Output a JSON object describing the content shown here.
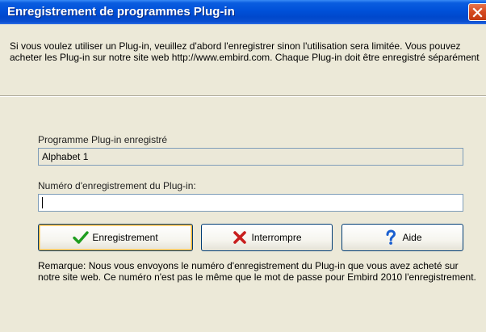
{
  "window": {
    "title": "Enregistrement de programmes Plug-in"
  },
  "intro_text": "Si vous voulez utiliser un Plug-in, veuillez d'abord l'enregistrer sinon l'utilisation sera limitée. Vous pouvez acheter les Plug-in sur notre site web http://www.embird.com. Chaque Plug-in doit être enregistré séparément",
  "form": {
    "registered_label": "Programme Plug-in enregistré",
    "registered_value": "Alphabet 1",
    "number_label": "Numéro d'enregistrement du Plug-in:",
    "number_value": ""
  },
  "buttons": {
    "register": "Enregistrement",
    "cancel": "Interrompre",
    "help": "Aide"
  },
  "remark_text": "Remarque: Nous vous envoyons le numéro d'enregistrement du Plug-in que vous avez acheté sur notre site web. Ce numéro n'est pas le même que le mot de passe pour Embird 2010 l'enregistrement.",
  "icons": {
    "close": "close-icon",
    "register": "green-checkmark-icon",
    "cancel": "red-x-icon",
    "help": "blue-question-mark-icon"
  },
  "colors": {
    "titlebar": "#0050d8",
    "window_bg": "#ece9d8",
    "close_button": "#d4491f",
    "check_green": "#1f9d1f",
    "x_red": "#c81e1e",
    "help_blue": "#1a5fd0"
  }
}
